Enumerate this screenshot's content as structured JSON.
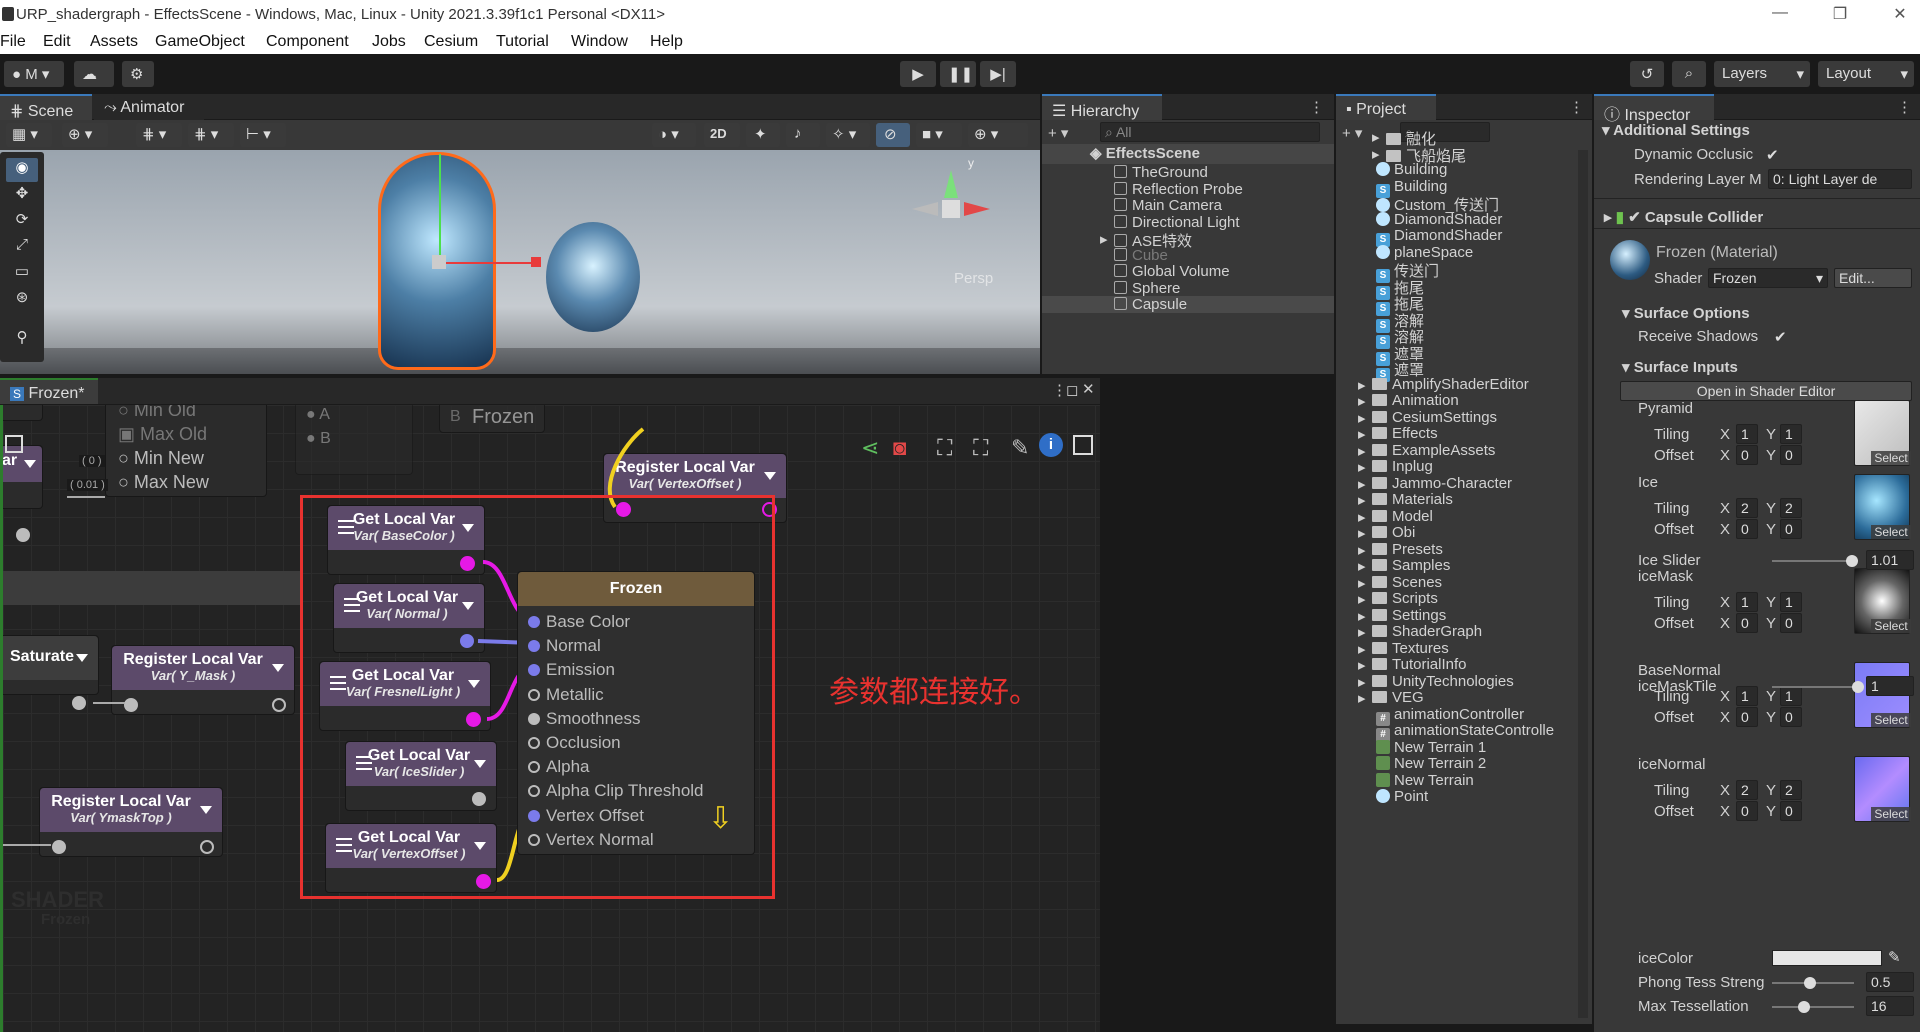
{
  "window": {
    "title": "URP_shadergraph - EffectsScene - Windows, Mac, Linux - Unity 2021.3.39f1c1 Personal <DX11>",
    "buttons": [
      "—",
      "❐",
      "✕"
    ]
  },
  "menu": [
    "File",
    "Edit",
    "Assets",
    "GameObject",
    "Component",
    "Jobs",
    "Cesium",
    "Tutorial",
    "Window",
    "Help"
  ],
  "toolbar": {
    "account": "M",
    "layers": "Layers",
    "layout": "Layout"
  },
  "scene": {
    "tabs": [
      "Scene",
      "Animator"
    ],
    "btn_2d": "2D",
    "persp": "Persp",
    "gizmo_y": "y"
  },
  "hierarchy": {
    "tab": "Hierarchy",
    "search": "All",
    "scene": "EffectsScene",
    "items": [
      "TheGround",
      "Reflection Probe",
      "Main Camera",
      "Directional Light",
      "ASE特效",
      "Cube",
      "Global Volume",
      "Sphere",
      "Capsule"
    ]
  },
  "project": {
    "tab": "Project",
    "items": [
      {
        "n": "融化",
        "t": "folder"
      },
      {
        "n": "飞船焰尾",
        "t": "folder"
      },
      {
        "n": "Building",
        "t": "mat"
      },
      {
        "n": "Building",
        "t": "shader"
      },
      {
        "n": "Custom_传送门",
        "t": "mat"
      },
      {
        "n": "DiamondShader",
        "t": "mat"
      },
      {
        "n": "DiamondShader",
        "t": "shader"
      },
      {
        "n": "planeSpace",
        "t": "mat"
      },
      {
        "n": "传送门",
        "t": "shader"
      },
      {
        "n": "拖尾",
        "t": "shader"
      },
      {
        "n": "拖尾",
        "t": "shader"
      },
      {
        "n": "溶解",
        "t": "shader"
      },
      {
        "n": "溶解",
        "t": "shader"
      },
      {
        "n": "遮罩",
        "t": "shader"
      },
      {
        "n": "遮罩",
        "t": "shader"
      },
      {
        "n": "AmplifyShaderEditor",
        "t": "folder"
      },
      {
        "n": "Animation",
        "t": "folder"
      },
      {
        "n": "CesiumSettings",
        "t": "folder"
      },
      {
        "n": "Effects",
        "t": "folder"
      },
      {
        "n": "ExampleAssets",
        "t": "folder"
      },
      {
        "n": "Inplug",
        "t": "folder"
      },
      {
        "n": "Jammo-Character",
        "t": "folder"
      },
      {
        "n": "Materials",
        "t": "folder"
      },
      {
        "n": "Model",
        "t": "folder"
      },
      {
        "n": "Obi",
        "t": "folder"
      },
      {
        "n": "Presets",
        "t": "folder"
      },
      {
        "n": "Samples",
        "t": "folder"
      },
      {
        "n": "Scenes",
        "t": "folder"
      },
      {
        "n": "Scripts",
        "t": "folder"
      },
      {
        "n": "Settings",
        "t": "folder"
      },
      {
        "n": "ShaderGraph",
        "t": "folder"
      },
      {
        "n": "Textures",
        "t": "folder"
      },
      {
        "n": "TutorialInfo",
        "t": "folder"
      },
      {
        "n": "UnityTechnologies",
        "t": "folder"
      },
      {
        "n": "VEG",
        "t": "folder"
      },
      {
        "n": "animationController",
        "t": "script"
      },
      {
        "n": "animationStateControlle",
        "t": "script"
      },
      {
        "n": "New Terrain 1",
        "t": "terrain"
      },
      {
        "n": "New Terrain 2",
        "t": "terrain"
      },
      {
        "n": "New Terrain",
        "t": "terrain"
      },
      {
        "n": "Point",
        "t": "mat"
      }
    ]
  },
  "inspector": {
    "tab": "Inspector",
    "additional": "Additional Settings",
    "dynamic_occlusion": "Dynamic Occlusic",
    "rendering_layer": "Rendering Layer M",
    "rendering_layer_val": "0: Light Layer de",
    "capsule_collider": "Capsule Collider",
    "material": "Frozen (Material)",
    "shader_lbl": "Shader",
    "shader_val": "Frozen",
    "edit": "Edit...",
    "surface_options": "Surface Options",
    "receive_shadows": "Receive Shadows",
    "surface_inputs": "Surface Inputs",
    "open_editor": "Open in Shader Editor",
    "tiling": "Tiling",
    "offset": "Offset",
    "x": "X",
    "y": "Y",
    "select": "Select",
    "textures": [
      {
        "name": "Pyramid",
        "tiling": [
          "1",
          "1"
        ],
        "offset": [
          "0",
          "0"
        ]
      },
      {
        "name": "Ice",
        "tiling": [
          "2",
          "2"
        ],
        "offset": [
          "0",
          "0"
        ]
      },
      {
        "name": "iceMask",
        "tiling": [
          "1",
          "1"
        ],
        "offset": [
          "0",
          "0"
        ]
      },
      {
        "name": "BaseNormal",
        "tiling": [
          "1",
          "1"
        ],
        "offset": [
          "0",
          "0"
        ]
      },
      {
        "name": "iceNormal",
        "tiling": [
          "2",
          "2"
        ],
        "offset": [
          "0",
          "0"
        ]
      }
    ],
    "ice_slider": "Ice Slider",
    "ice_slider_val": "1.01",
    "icemask_tile": "iceMaskTile",
    "icemask_tile_val": "1",
    "ice_color": "iceColor",
    "phong": "Phong Tess Streng",
    "phong_val": "0.5",
    "max_tess": "Max Tessellation",
    "max_tess_val": "16"
  },
  "graph": {
    "tab": "Frozen*",
    "frozen_bg": "Frozen",
    "watermark": "SHADER",
    "watermark_sub": "Frozen",
    "remap": {
      "min_old": "Min Old",
      "max_old": "Max Old",
      "min_new": "Min New",
      "max_new": "Max New",
      "v0": "( 0 )",
      "v1": "( 0 )",
      "v2": "( 0.01 )"
    },
    "ab": [
      "A",
      "B"
    ],
    "b_label": "B",
    "saturate": "Saturate",
    "reg_ymask": {
      "t": "Register Local Var",
      "s": "Var( Y_Mask )"
    },
    "reg_ymasktop": {
      "t": "Register Local Var",
      "s": "Var( YmaskTop )"
    },
    "reg_vertex": {
      "t": "Register Local Var",
      "s": "Var( VertexOffset )"
    },
    "get_nodes": [
      {
        "t": "Get Local Var",
        "s": "Var( BaseColor )"
      },
      {
        "t": "Get Local Var",
        "s": "Var( Normal )"
      },
      {
        "t": "Get Local Var",
        "s": "Var( FresnelLight )"
      },
      {
        "t": "Get Local Var",
        "s": "Var( IceSlider )"
      },
      {
        "t": "Get Local Var",
        "s": "Var( VertexOffset )"
      }
    ],
    "frozen_node": {
      "title": "Frozen",
      "inputs": [
        "Base Color",
        "Normal",
        "Emission",
        "Metallic",
        "Smoothness",
        "Occlusion",
        "Alpha",
        "Alpha Clip Threshold",
        "Vertex Offset",
        "Vertex Normal"
      ]
    },
    "annotation": "参数都连接好。",
    "ar_label": "ar"
  },
  "colors": {
    "accent": "#3a79bb",
    "annotation": "#e8322f",
    "pin_magenta": "#e619e6",
    "pin_blue": "#7b7bea",
    "node_header": "#5c4a6a",
    "frozen_header": "#6f5b3c"
  }
}
